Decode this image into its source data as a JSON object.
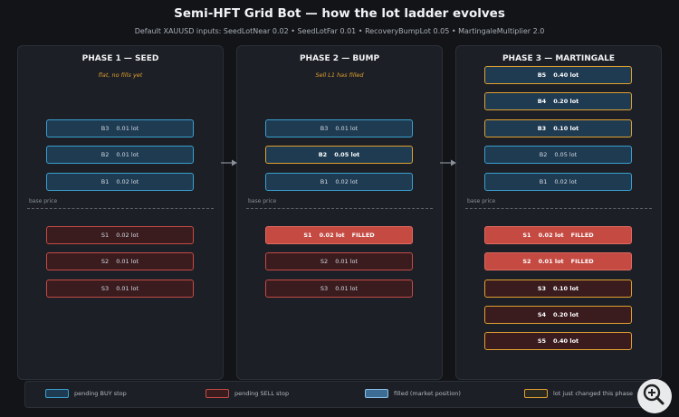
{
  "header": {
    "title": "Semi-HFT Grid Bot  —  how the lot ladder evolves",
    "subtitle": "Default XAUUSD inputs: SeedLotNear 0.02  •  SeedLotFar 0.01  •  RecoveryBumpLot 0.05  •  MartingaleMultiplier 2.0"
  },
  "base_price_label": "base price",
  "phases": [
    {
      "title": "PHASE 1 — SEED",
      "note": "flat, no fills yet",
      "buys": [
        {
          "id": "B3",
          "lot": "0.01 lot",
          "state": "pending"
        },
        {
          "id": "B2",
          "lot": "0.01 lot",
          "state": "pending"
        },
        {
          "id": "B1",
          "lot": "0.02 lot",
          "state": "pending"
        }
      ],
      "sells": [
        {
          "id": "S1",
          "lot": "0.02 lot",
          "state": "pending",
          "tag": ""
        },
        {
          "id": "S2",
          "lot": "0.01 lot",
          "state": "pending",
          "tag": ""
        },
        {
          "id": "S3",
          "lot": "0.01 lot",
          "state": "pending",
          "tag": ""
        }
      ]
    },
    {
      "title": "PHASE 2 — BUMP",
      "note": "Sell L1 has filled",
      "buys": [
        {
          "id": "B3",
          "lot": "0.01 lot",
          "state": "pending"
        },
        {
          "id": "B2",
          "lot": "0.05 lot",
          "state": "changed"
        },
        {
          "id": "B1",
          "lot": "0.02 lot",
          "state": "pending"
        }
      ],
      "sells": [
        {
          "id": "S1",
          "lot": "0.02 lot",
          "state": "filled",
          "tag": "FILLED"
        },
        {
          "id": "S2",
          "lot": "0.01 lot",
          "state": "pending",
          "tag": ""
        },
        {
          "id": "S3",
          "lot": "0.01 lot",
          "state": "pending",
          "tag": ""
        }
      ]
    },
    {
      "title": "PHASE 3 — MARTINGALE",
      "note": "",
      "buys": [
        {
          "id": "B5",
          "lot": "0.40 lot",
          "state": "changed"
        },
        {
          "id": "B4",
          "lot": "0.20 lot",
          "state": "changed"
        },
        {
          "id": "B3",
          "lot": "0.10 lot",
          "state": "changed"
        },
        {
          "id": "B2",
          "lot": "0.05 lot",
          "state": "pending"
        },
        {
          "id": "B1",
          "lot": "0.02 lot",
          "state": "pending"
        }
      ],
      "sells": [
        {
          "id": "S1",
          "lot": "0.02 lot",
          "state": "filled",
          "tag": "FILLED"
        },
        {
          "id": "S2",
          "lot": "0.01 lot",
          "state": "filled",
          "tag": "FILLED"
        },
        {
          "id": "S3",
          "lot": "0.10 lot",
          "state": "changed",
          "tag": ""
        },
        {
          "id": "S4",
          "lot": "0.20 lot",
          "state": "changed",
          "tag": ""
        },
        {
          "id": "S5",
          "lot": "0.40 lot",
          "state": "changed",
          "tag": ""
        }
      ]
    }
  ],
  "legend": {
    "buy": "pending BUY stop",
    "sell": "pending SELL stop",
    "filled": "filled (market position)",
    "changed": "lot just changed this phase"
  },
  "colors": {
    "buy_border": "#3aa0d0",
    "sell_border": "#c44a45",
    "filled": "#c44a42",
    "changed": "#e0a030",
    "background": "#121418"
  }
}
